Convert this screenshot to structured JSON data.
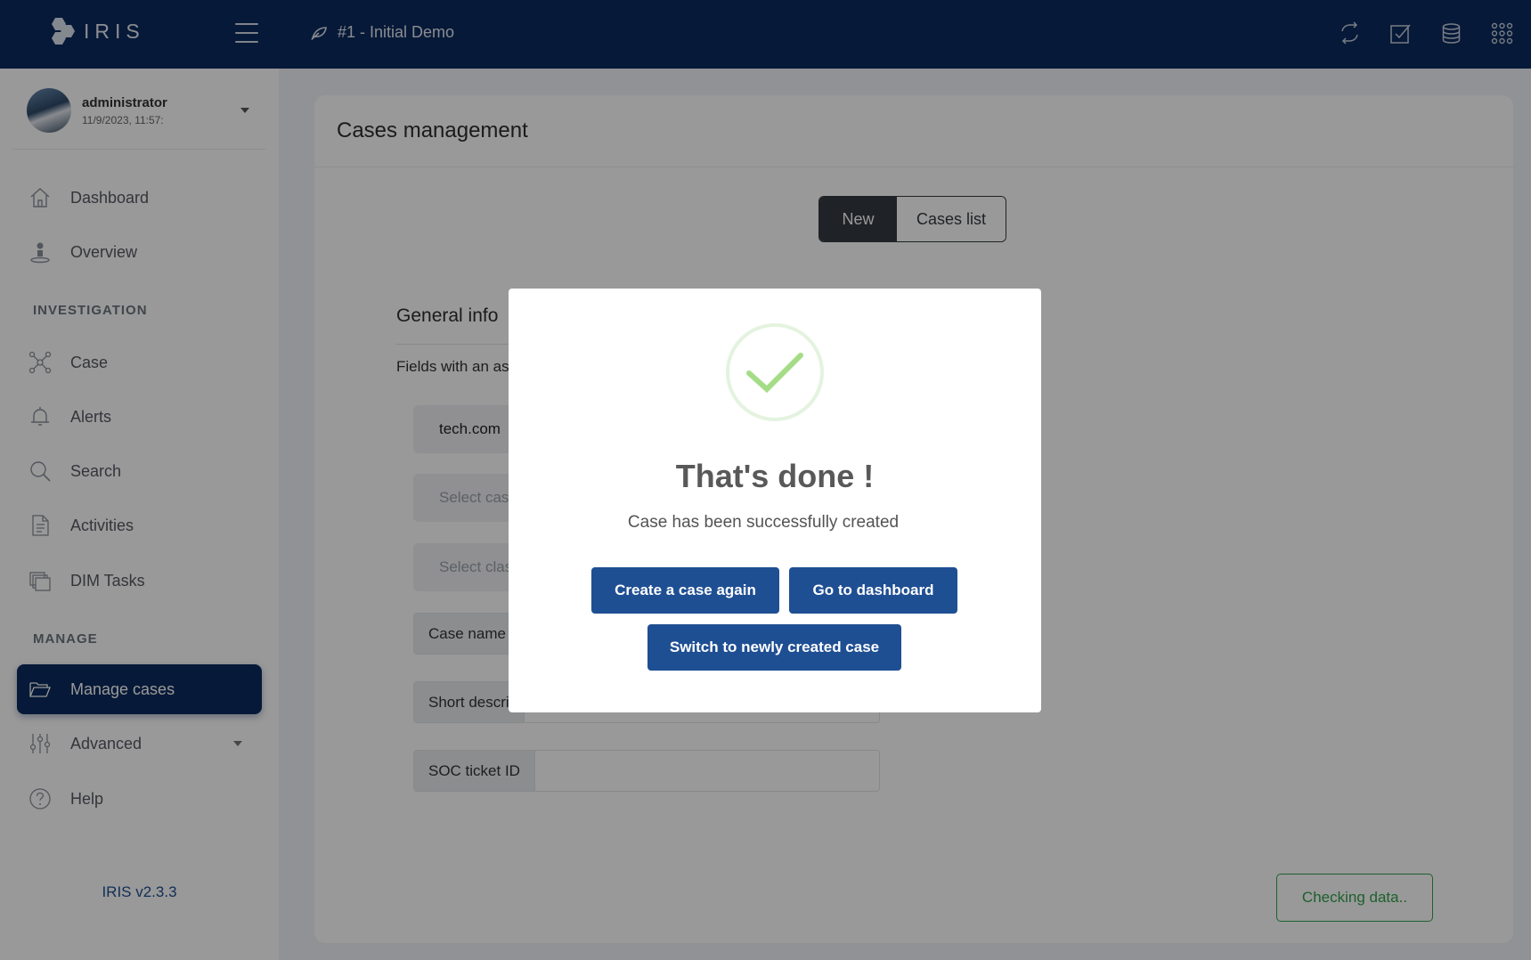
{
  "app": {
    "logo_text": "IRIS",
    "case_title": "#1 - Initial Demo"
  },
  "top_icons": [
    "refresh-icon",
    "checkbox-icon",
    "database-icon",
    "apps-grid-icon"
  ],
  "user": {
    "name": "administrator",
    "date": "11/9/2023, 11:57:"
  },
  "sidebar": {
    "dashboard": "Dashboard",
    "overview": "Overview",
    "investigation_title": "INVESTIGATION",
    "case": "Case",
    "alerts": "Alerts",
    "search": "Search",
    "activities": "Activities",
    "dim_tasks": "DIM Tasks",
    "manage_title": "MANAGE",
    "manage_cases": "Manage cases",
    "advanced": "Advanced",
    "help": "Help",
    "version": "IRIS v2.3.3"
  },
  "main": {
    "title": "Cases management",
    "tab_new": "New",
    "tab_list": "Cases list",
    "general_info": "General info",
    "fields_note": "Fields with an as",
    "customer_value": "tech.com",
    "select_case_placeholder": "Select case",
    "select_class_placeholder": "Select clas",
    "case_name_label": "Case name *",
    "short_desc_label": "Short descri",
    "soc_ticket_label": "SOC ticket ID",
    "checking_button": "Checking data.."
  },
  "modal": {
    "title": "That's done !",
    "text": "Case has been successfully created",
    "btn_create_again": "Create a case again",
    "btn_dashboard": "Go to dashboard",
    "btn_switch": "Switch to newly created case"
  },
  "colors": {
    "topbar": "#0b2a5e",
    "primary_button": "#1f4f93",
    "success": "#31a24c",
    "check": "#a5dc86"
  }
}
